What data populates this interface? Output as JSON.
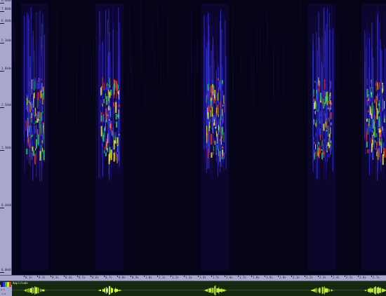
{
  "frequency_axis": {
    "labels": [
      "6.4kHz",
      "7.8kHz",
      "6.4kHz",
      "5.1kHz",
      "3.8kHz",
      "2.56kHz",
      "1.3kHz",
      "0.44kHz",
      "0.0kHz"
    ]
  },
  "time_axis": {
    "labels": [
      "0.1s",
      "0.2s",
      "0.3s",
      "0.4s",
      "0.5s",
      "0.6s",
      "0.7s",
      "0.8s",
      "0.9s",
      "1.0s",
      "1.1s",
      "1.2s",
      "1.3s",
      "1.4s",
      "1.5s",
      "1.6s",
      "1.7s",
      "1.8s",
      "1.9s",
      "2.0s",
      "2.1s",
      "2.2s",
      "2.3s",
      "2.4s",
      "2.5s",
      "2.6s",
      "2.7s"
    ]
  },
  "waveform": {
    "title": "Amplitude",
    "axis_labels": [
      "1.0",
      "0.0",
      "-1.0"
    ]
  },
  "bursts": [
    {
      "center_time": 0.17
    },
    {
      "center_time": 0.73
    },
    {
      "center_time": 1.52
    },
    {
      "center_time": 2.32
    },
    {
      "center_time": 2.72
    }
  ],
  "colors": {
    "background": "#050318",
    "ruler": "#a9a8cc",
    "waveform_background": "#16280f",
    "waveform_signal": "#d8ff40",
    "scale": [
      "#1a0a6a",
      "#3030d0",
      "#20c060",
      "#e0e030",
      "#e03020"
    ]
  }
}
